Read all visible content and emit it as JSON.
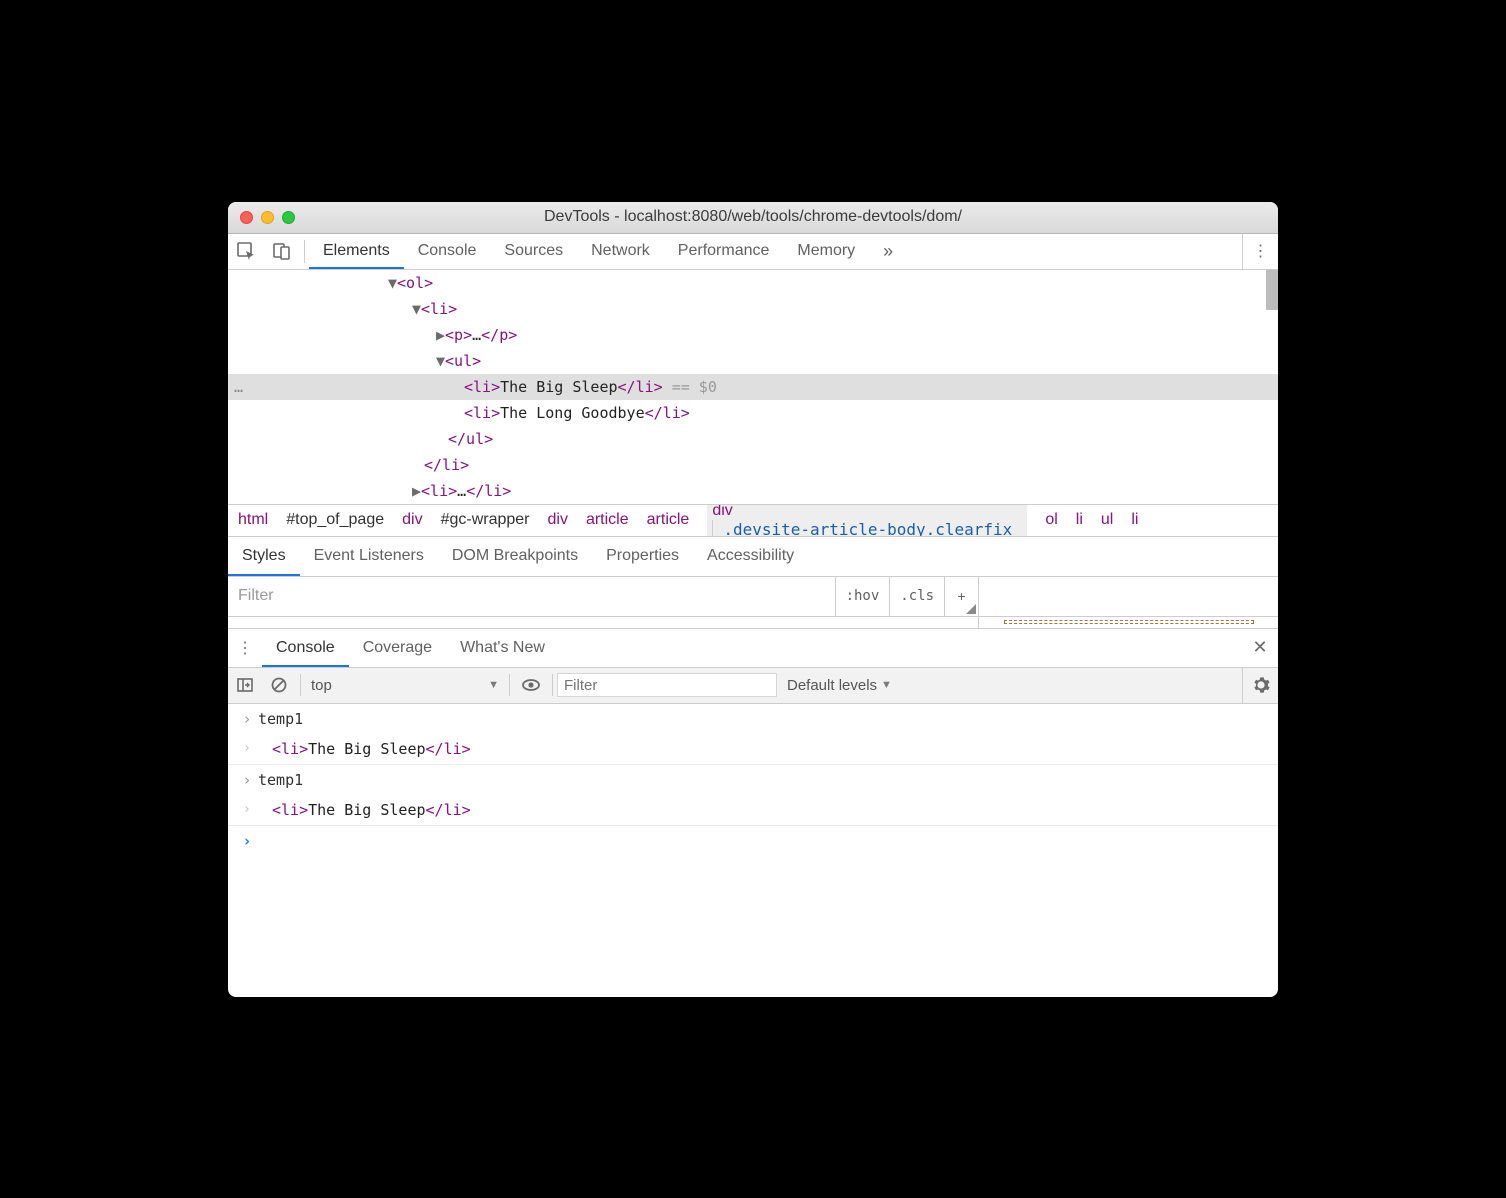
{
  "window": {
    "title": "DevTools - localhost:8080/web/tools/chrome-devtools/dom/"
  },
  "tabs": {
    "items": [
      "Elements",
      "Console",
      "Sources",
      "Network",
      "Performance",
      "Memory"
    ],
    "active": "Elements",
    "overflow_glyph": "»"
  },
  "dom": {
    "lines": [
      {
        "indent": 160,
        "arrow": "▼",
        "open": "<ol>",
        "text": "",
        "close": ""
      },
      {
        "indent": 184,
        "arrow": "▼",
        "open": "<li>",
        "text": "",
        "close": ""
      },
      {
        "indent": 208,
        "arrow": "▶",
        "open": "<p>",
        "text": "…",
        "close": "</p>"
      },
      {
        "indent": 208,
        "arrow": "▼",
        "open": "<ul>",
        "text": "",
        "close": ""
      },
      {
        "indent": 236,
        "arrow": "",
        "open": "<li>",
        "text": "The Big Sleep",
        "close": "</li>",
        "selected": true,
        "after": " == $0"
      },
      {
        "indent": 236,
        "arrow": "",
        "open": "<li>",
        "text": "The Long Goodbye",
        "close": "</li>"
      },
      {
        "indent": 220,
        "arrow": "",
        "open": "</ul>",
        "text": "",
        "close": ""
      },
      {
        "indent": 196,
        "arrow": "",
        "open": "</li>",
        "text": "",
        "close": ""
      },
      {
        "indent": 184,
        "arrow": "▶",
        "open": "<li>",
        "text": "…",
        "close": "</li>"
      }
    ]
  },
  "breadcrumbs": [
    {
      "tag": "html"
    },
    {
      "hash": "#top_of_page"
    },
    {
      "tag": "div"
    },
    {
      "hash": "#gc-wrapper"
    },
    {
      "tag": "div"
    },
    {
      "tag": "article"
    },
    {
      "tag": "article"
    },
    {
      "tag": "div",
      "cls": ".devsite-article-body.clearfix",
      "selected": true
    },
    {
      "tag": "ol"
    },
    {
      "tag": "li"
    },
    {
      "tag": "ul"
    },
    {
      "tag": "li"
    }
  ],
  "style_tabs": {
    "items": [
      "Styles",
      "Event Listeners",
      "DOM Breakpoints",
      "Properties",
      "Accessibility"
    ],
    "active": "Styles"
  },
  "style_filter": {
    "placeholder": "Filter",
    "hov": ":hov",
    "cls": ".cls",
    "plus": "+"
  },
  "drawer_tabs": {
    "items": [
      "Console",
      "Coverage",
      "What's New"
    ],
    "active": "Console"
  },
  "console_toolbar": {
    "context": "top",
    "filter_placeholder": "Filter",
    "levels": "Default levels",
    "caret": "▾"
  },
  "console_entries": [
    {
      "input": "temp1",
      "output_open": "<li>",
      "output_text": "The Big Sleep",
      "output_close": "</li>"
    },
    {
      "input": "temp1",
      "output_open": "<li>",
      "output_text": "The Big Sleep",
      "output_close": "</li>"
    }
  ],
  "glyphs": {
    "close": "✕",
    "kebab": "⋮",
    "caret_down": "▼",
    "prompt_in": "›",
    "prompt_out": "‹",
    "prompt_ready": "›"
  }
}
